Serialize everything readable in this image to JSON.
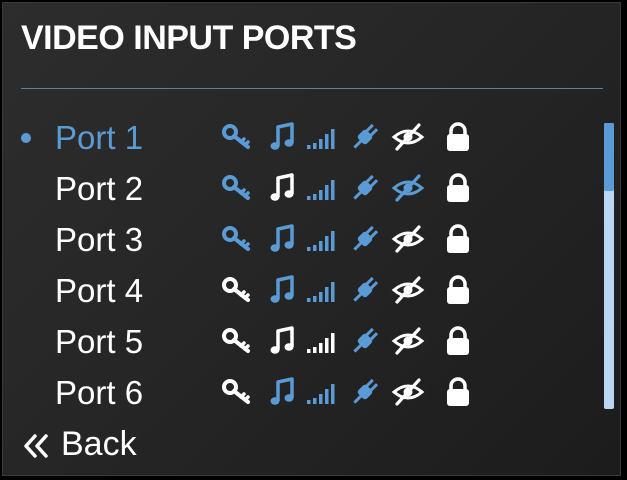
{
  "header": {
    "title": "VIDEO INPUT PORTS"
  },
  "colors": {
    "accent": "#5b9bd5",
    "inactive": "#ffffff",
    "track": "#b9d6f2"
  },
  "ports": [
    {
      "label": "Port 1",
      "selected": true,
      "icons": {
        "key": "blue",
        "music": "blue",
        "signal": "blue",
        "plug": "blue",
        "eye_off": "white",
        "lock": "white"
      }
    },
    {
      "label": "Port 2",
      "selected": false,
      "icons": {
        "key": "blue",
        "music": "white",
        "signal": "blue",
        "plug": "blue",
        "eye_off": "blue",
        "lock": "white"
      }
    },
    {
      "label": "Port 3",
      "selected": false,
      "icons": {
        "key": "blue",
        "music": "blue",
        "signal": "blue",
        "plug": "blue",
        "eye_off": "white",
        "lock": "white"
      }
    },
    {
      "label": "Port 4",
      "selected": false,
      "icons": {
        "key": "white",
        "music": "blue",
        "signal": "blue",
        "plug": "blue",
        "eye_off": "white",
        "lock": "white"
      }
    },
    {
      "label": "Port 5",
      "selected": false,
      "icons": {
        "key": "white",
        "music": "white",
        "signal": "white",
        "plug": "blue",
        "eye_off": "white",
        "lock": "white"
      }
    },
    {
      "label": "Port 6",
      "selected": false,
      "icons": {
        "key": "white",
        "music": "blue",
        "signal": "blue",
        "plug": "blue",
        "eye_off": "white",
        "lock": "white"
      }
    }
  ],
  "icon_names": [
    "key-icon",
    "music-note-icon",
    "signal-bars-icon",
    "plug-icon",
    "eye-off-icon",
    "lock-icon"
  ],
  "footer": {
    "back_label": "Back",
    "back_icon": "double-chevron-left-icon"
  }
}
